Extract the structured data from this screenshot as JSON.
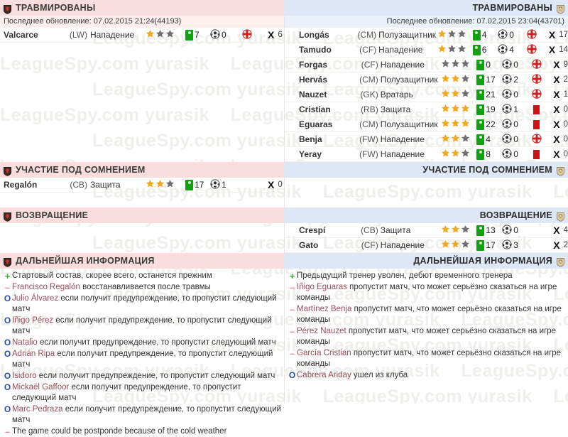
{
  "watermark": {
    "text": "LeagueSpy.com  yurasik"
  },
  "colors": {
    "left_header_bg": "#fadedd",
    "right_header_bg": "#dde7f6",
    "left_update_bg": "#fdefee",
    "right_update_bg": "#eaf1fb",
    "green_badge": "#139e13",
    "red_card": "#cc1212",
    "star_on": "#f0a81e",
    "star_off": "#6f6f6f",
    "plus": "#36a836",
    "minus": "#e08a94",
    "circle": "#2b4ea8"
  },
  "left": {
    "injured": {
      "title": "ТРАВМИРОВАНЫ",
      "update_label": "Последнее обновление: 07.02.2015 21:24(44193)",
      "players": [
        {
          "name": "Valcarce",
          "pos": "(LW)",
          "role": "Нападение",
          "stars": 1,
          "apps": "7",
          "goals": "0",
          "status": "injury",
          "x": "6"
        }
      ]
    },
    "doubtful": {
      "title": "УЧАСТИЕ ПОД СОМНЕНИЕМ",
      "players": [
        {
          "name": "Regalón",
          "pos": "(CB)",
          "role": "Защита",
          "stars": 2,
          "apps": "17",
          "goals": "1",
          "status": "none",
          "x": "0"
        }
      ]
    },
    "returning": {
      "title": "ВОЗВРАЩЕНИЕ",
      "players": []
    },
    "further": {
      "title": "ДАЛЬНЕЙШАЯ ИНФОРМАЦИЯ",
      "items": [
        {
          "mark": "plus",
          "who": "",
          "text": "Стартовый состав, скорее всего, останется прежним"
        },
        {
          "mark": "minus",
          "who": "Francisco Regalón",
          "text": " восстанавливается после травмы"
        },
        {
          "mark": "circ",
          "who": "Julio Álvarez",
          "text": " если получит предупреждение, то пропустит следующий матч"
        },
        {
          "mark": "circ",
          "who": "Iñigo Pérez",
          "text": " если получит предупреждение, то пропустит следующий матч"
        },
        {
          "mark": "circ",
          "who": " Natalio",
          "text": " если получит предупреждение, то пропустит следующий матч"
        },
        {
          "mark": "circ",
          "who": "Adrián Ripa",
          "text": " если получит предупреждение, то пропустит следующий матч"
        },
        {
          "mark": "circ",
          "who": " Isidoro",
          "text": " если получит предупреждение, то пропустит следующий матч"
        },
        {
          "mark": "circ",
          "who": "Mickaël Gaffoor",
          "text": " если получит предупреждение, то пропустит следующий матч"
        },
        {
          "mark": "circ",
          "who": "Marc Pedraza",
          "text": " если получит предупреждение, то пропустит следующий матч"
        },
        {
          "mark": "minus",
          "who": "",
          "text": "The game could be postponde because of the cold weather"
        }
      ]
    }
  },
  "right": {
    "injured": {
      "title": "ТРАВМИРОВАНЫ",
      "update_label": "Последнее обновление: 07.02.2015 23:04(43701)",
      "players": [
        {
          "name": "Longás",
          "pos": "(CM)",
          "role": "Полузащитник",
          "stars": 1,
          "apps": "4",
          "goals": "0",
          "status": "injury",
          "x": "17"
        },
        {
          "name": "Tamudo",
          "pos": "(CF)",
          "role": "Нападение",
          "stars": 1,
          "apps": "6",
          "goals": "4",
          "status": "injury",
          "x": "14"
        },
        {
          "name": "Forgas",
          "pos": "(CF)",
          "role": "Нападение",
          "stars": 0,
          "apps": "0",
          "goals": "0",
          "status": "injury",
          "x": "9"
        },
        {
          "name": "Hervás",
          "pos": "(CM)",
          "role": "Полузащитник",
          "stars": 2,
          "apps": "17",
          "goals": "2",
          "status": "injury",
          "x": "2"
        },
        {
          "name": "Nauzet",
          "pos": "(GK)",
          "role": "Вратарь",
          "stars": 2,
          "apps": "21",
          "goals": "0",
          "status": "injury",
          "x": "1"
        },
        {
          "name": "Cristian",
          "pos": "(RB)",
          "role": "Защита",
          "stars": 3,
          "apps": "19",
          "goals": "1",
          "status": "card",
          "x": "0"
        },
        {
          "name": "Eguaras",
          "pos": "(CM)",
          "role": "Полузащитник",
          "stars": 3,
          "apps": "22",
          "goals": "0",
          "status": "card",
          "x": "0"
        },
        {
          "name": "Benja",
          "pos": "(FW)",
          "role": "Нападение",
          "stars": 2,
          "apps": "4",
          "goals": "0",
          "status": "injury",
          "x": "0"
        },
        {
          "name": "Yeray",
          "pos": "(FW)",
          "role": "Нападение",
          "stars": 2,
          "apps": "8",
          "goals": "0",
          "status": "card",
          "x": "0"
        }
      ]
    },
    "doubtful": {
      "title": "УЧАСТИЕ ПОД СОМНЕНИЕМ",
      "players": []
    },
    "returning": {
      "title": "ВОЗВРАЩЕНИЕ",
      "players": [
        {
          "name": "Crespí",
          "pos": "(CB)",
          "role": "Защита",
          "stars": 2,
          "apps": "13",
          "goals": "0",
          "status": "none",
          "x": "4"
        },
        {
          "name": "Gato",
          "pos": "(CF)",
          "role": "Нападение",
          "stars": 2,
          "apps": "17",
          "goals": "3",
          "status": "none",
          "x": "2"
        }
      ]
    },
    "further": {
      "title": "ДАЛЬНЕЙШАЯ ИНФОРМАЦИЯ",
      "items": [
        {
          "mark": "plus",
          "who": "",
          "text": "Предыдущий тренер уволен, дебют временного тренера"
        },
        {
          "mark": "minus",
          "who": "Iñigo Eguaras",
          "text": " пропустит матч, что может серьёзно сказаться на игре команды"
        },
        {
          "mark": "minus",
          "who": "Martínez Benja",
          "text": " пропустит матч, что может серьёзно сказаться на игре команды"
        },
        {
          "mark": "minus",
          "who": "Pérez Nauzet",
          "text": " пропустит матч, что может серьёзно сказаться на игре команды"
        },
        {
          "mark": "minus",
          "who": "García Cristian",
          "text": " пропустит матч, что может серьёзно сказаться на игре команды"
        },
        {
          "mark": "circ",
          "who": "Cabrera Ariday",
          "text": " ушел из клуба"
        }
      ]
    }
  },
  "icons": {
    "crest_left": "crest-icon",
    "crest_right": "crest-icon",
    "appearances": "green-shirt-badge-icon",
    "goals": "football-icon",
    "injury": "red-cross-medical-icon",
    "suspension": "red-card-icon",
    "miss_count": "x-mark-icon"
  }
}
